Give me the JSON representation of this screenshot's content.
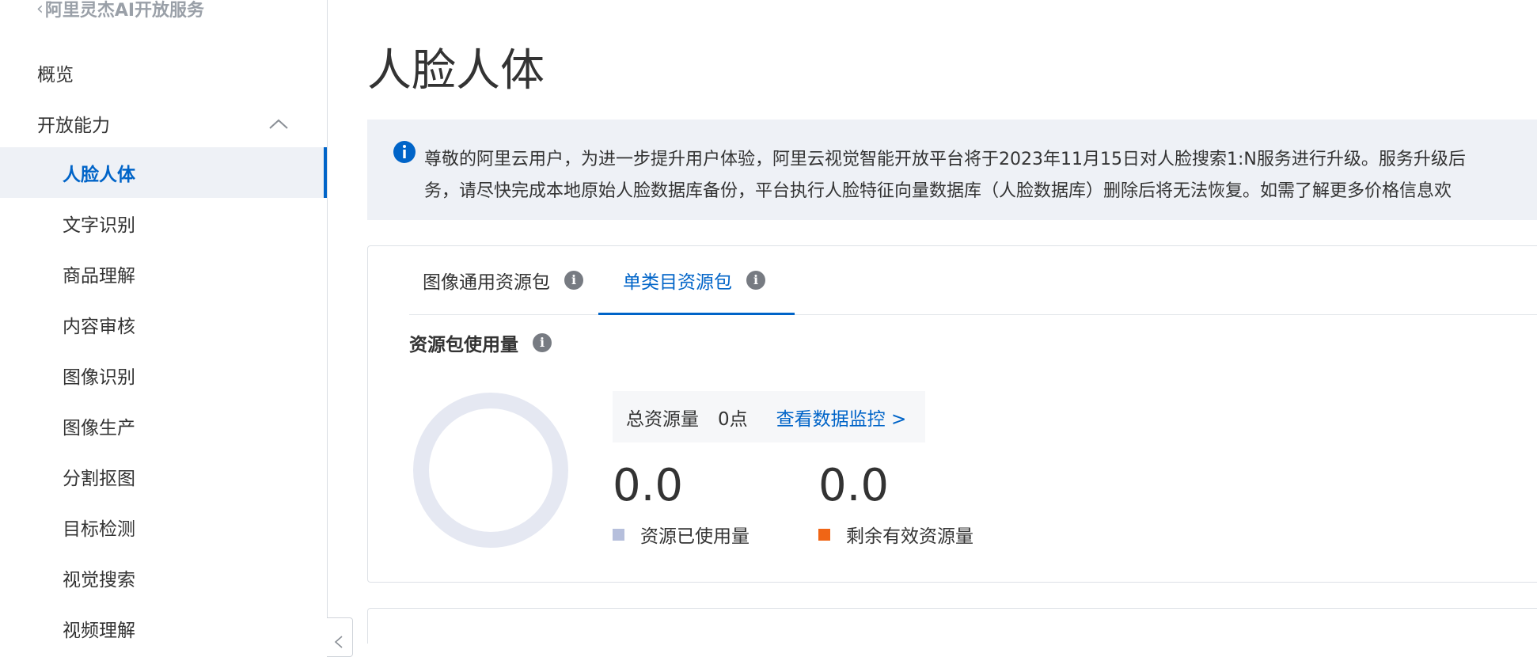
{
  "sidebar": {
    "back_label": "阿里灵杰AI开放服务",
    "items": [
      {
        "label": "概览"
      },
      {
        "label": "开放能力"
      },
      {
        "label": "人脸人体"
      },
      {
        "label": "文字识别"
      },
      {
        "label": "商品理解"
      },
      {
        "label": "内容审核"
      },
      {
        "label": "图像识别"
      },
      {
        "label": "图像生产"
      },
      {
        "label": "分割抠图"
      },
      {
        "label": "目标检测"
      },
      {
        "label": "视觉搜索"
      },
      {
        "label": "视频理解"
      }
    ]
  },
  "main": {
    "title": "人脸人体",
    "notice": {
      "line1": "尊敬的阿里云用户，为进一步提升用户体验，阿里云视觉智能开放平台将于2023年11月15日对人脸搜索1:N服务进行升级。服务升级后",
      "line2": "务，请尽快完成本地原始人脸数据库备份，平台执行人脸特征向量数据库（人脸数据库）删除后将无法恢复。如需了解更多价格信息欢"
    },
    "tabs": [
      {
        "label": "图像通用资源包"
      },
      {
        "label": "单类目资源包"
      }
    ],
    "usage": {
      "title": "资源包使用量",
      "total_label": "总资源量",
      "total_value": "0点",
      "monitor_link": "查看数据监控 >",
      "used_value": "0.0",
      "used_label": "资源已使用量",
      "remaining_value": "0.0",
      "remaining_label": "剩余有效资源量",
      "used_fraction": 0
    }
  },
  "colors": {
    "accent": "#0064c8",
    "used_swatch": "#b6bfdc",
    "remaining_swatch": "#f06515",
    "donut_track": "#e5e8f2"
  }
}
